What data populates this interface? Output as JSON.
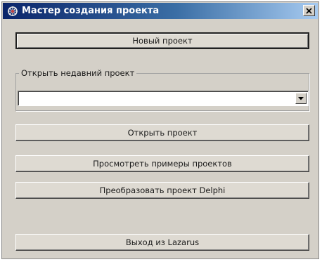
{
  "window": {
    "title": "Мастер создания проекта"
  },
  "icons": {
    "app": "lazarus-app-icon",
    "close": "close-icon",
    "dropdown": "chevron-down-icon"
  },
  "buttons": {
    "new_project": "Новый проект",
    "open_project": "Открыть проект",
    "view_examples": "Просмотреть примеры проектов",
    "convert_delphi": "Преобразовать проект Delphi",
    "exit": "Выход из Lazarus"
  },
  "recent": {
    "group_label": "Открыть недавний проект",
    "selected_value": ""
  },
  "colors": {
    "titlebar_start": "#0a246a",
    "titlebar_end": "#a6caf0",
    "face": "#d4d0c8"
  }
}
